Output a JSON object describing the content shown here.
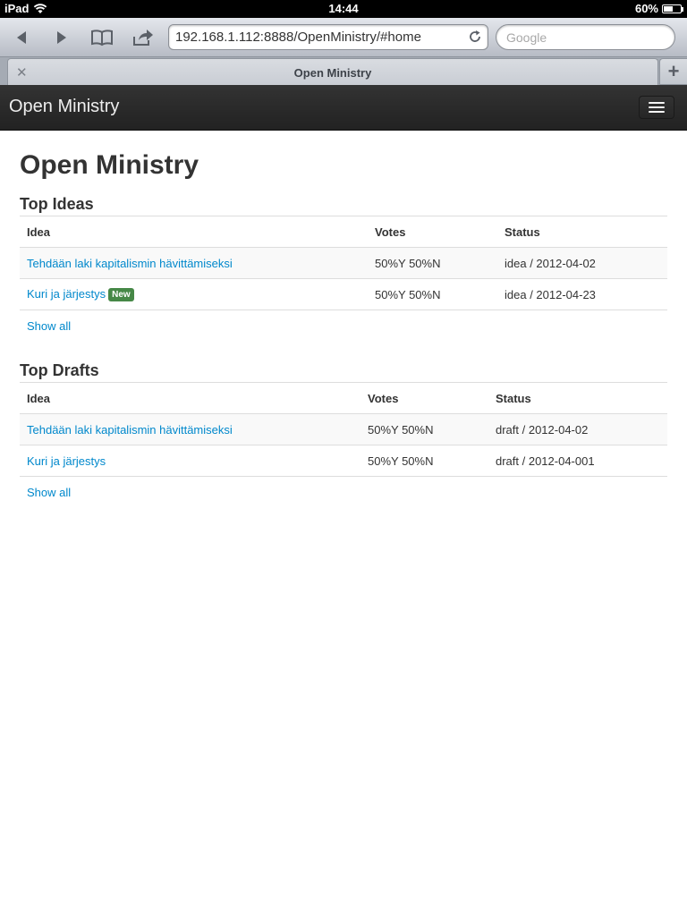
{
  "status_bar": {
    "device": "iPad",
    "time": "14:44",
    "battery": "60%",
    "battery_level": 0.6
  },
  "browser": {
    "url": "192.168.1.112:8888/OpenMinistry/#home",
    "search_placeholder": "Google",
    "tab_title": "Open Ministry"
  },
  "navbar": {
    "brand": "Open Ministry"
  },
  "page": {
    "title": "Open Ministry",
    "top_ideas": {
      "heading": "Top Ideas",
      "columns": [
        "Idea",
        "Votes",
        "Status"
      ],
      "rows": [
        {
          "idea": "Tehdään laki kapitalismin hävittämiseksi",
          "badge": "",
          "votes": "50%Y 50%N",
          "status": "idea / 2012-04-02"
        },
        {
          "idea": "Kuri ja järjestys",
          "badge": "New",
          "votes": "50%Y 50%N",
          "status": "idea / 2012-04-23"
        }
      ],
      "show_all": "Show all"
    },
    "top_drafts": {
      "heading": "Top Drafts",
      "columns": [
        "Idea",
        "Votes",
        "Status"
      ],
      "rows": [
        {
          "idea": "Tehdään laki kapitalismin hävittämiseksi",
          "votes": "50%Y 50%N",
          "status": "draft / 2012-04-02"
        },
        {
          "idea": "Kuri ja järjestys",
          "votes": "50%Y 50%N",
          "status": "draft / 2012-04-001"
        }
      ],
      "show_all": "Show all"
    }
  },
  "colors": {
    "link": "#0088cc",
    "badge_new": "#468847",
    "navbar": "#222222"
  }
}
